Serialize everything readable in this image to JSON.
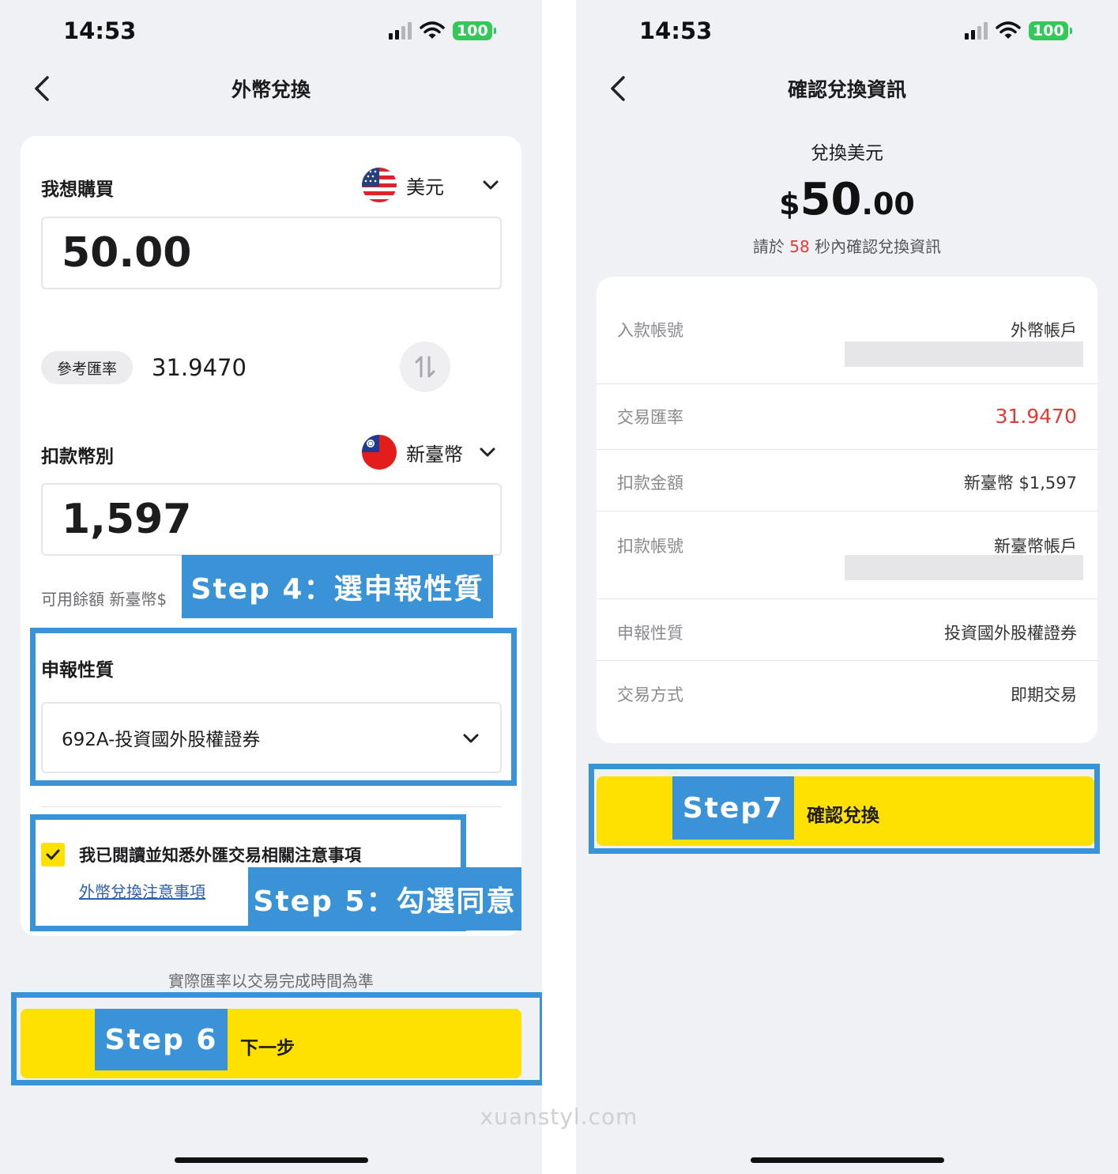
{
  "left_screen": {
    "status": {
      "time": "14:53",
      "battery": "100"
    },
    "nav": {
      "title": "外幣兌換"
    },
    "buy": {
      "label": "我想購買",
      "currency": "美元",
      "amount": "50.00"
    },
    "rate": {
      "label": "參考匯率",
      "value": "31.9470"
    },
    "debit": {
      "label": "扣款幣別",
      "currency": "新臺幣",
      "amount": "1,597"
    },
    "balance": {
      "text": "可用餘額 新臺幣$"
    },
    "declaration": {
      "label": "申報性質",
      "selected": "692A-投資國外股權證券"
    },
    "agreement": {
      "text": "我已閱讀並知悉外匯交易相關注意事項",
      "link": "外幣兌換注意事項"
    },
    "footnote": "實際匯率以交易完成時間為準",
    "next_button": "下一步"
  },
  "right_screen": {
    "status": {
      "time": "14:53",
      "battery": "100"
    },
    "nav": {
      "title": "確認兌換資訊"
    },
    "summary": {
      "title": "兌換美元",
      "currency_symbol": "$",
      "amount_int": "50",
      "amount_dec": ".00",
      "timer_prefix": "請於",
      "timer_seconds": "58",
      "timer_suffix": "秒內確認兌換資訊"
    },
    "details": [
      {
        "label": "入款帳號",
        "value": "外幣帳戶"
      },
      {
        "label": "交易匯率",
        "value": "31.9470"
      },
      {
        "label": "扣款金額",
        "value": "新臺幣 $1,597"
      },
      {
        "label": "扣款帳號",
        "value": "新臺幣帳戶"
      },
      {
        "label": "申報性質",
        "value": "投資國外股權證券"
      },
      {
        "label": "交易方式",
        "value": "即期交易"
      }
    ],
    "confirm_button": "確認兌換"
  },
  "annotations": {
    "step4": "Step 4：選申報性質",
    "step5": "Step 5：勾選同意",
    "step6": "Step 6",
    "step7": "Step7"
  },
  "watermark": "xuanstyl.com",
  "colors": {
    "accent_yellow": "#ffe100",
    "annotation_blue": "#3a93d7",
    "highlight_red": "#e53935",
    "link_blue": "#2f5fae"
  }
}
